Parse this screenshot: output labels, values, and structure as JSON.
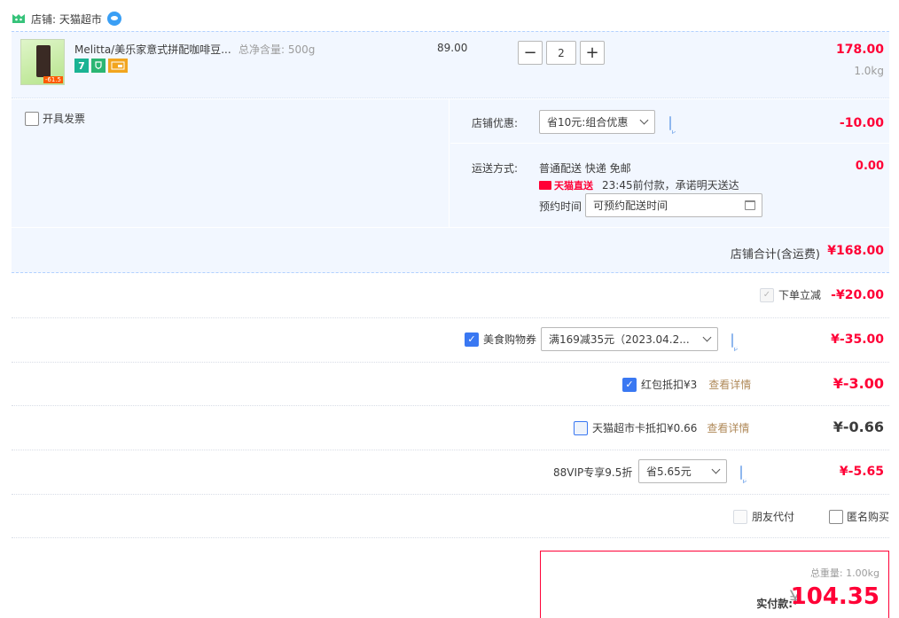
{
  "shop": {
    "label": "店铺: 天猫超市"
  },
  "item": {
    "title": "Melitta/美乐家意式拼配咖啡豆...",
    "spec": "总净含量: 500g",
    "badges": [
      "7",
      "",
      ""
    ],
    "unit_price": "89.00",
    "qty_minus": "−",
    "qty": "2",
    "qty_plus": "+",
    "sum": "178.00",
    "weight": "1.0kg",
    "thumb_tag": "-61.5"
  },
  "options": {
    "invoice_label": "开具发票",
    "shop_discount_label": "店铺优惠:",
    "shop_discount_value": "省10元:组合优惠",
    "shop_discount_amount": "-10.00",
    "delivery_label": "运送方式:",
    "delivery_value": "普通配送 快递 免邮",
    "delivery_amount": "0.00",
    "tmall_direct": "天猫直送",
    "delivery_promise": "23:45前付款，承诺明天送达",
    "schedule_label": "预约时间",
    "schedule_placeholder": "可预约配送时间",
    "shop_total": "店铺合计(含运费)",
    "shop_total_amount": "¥168.00"
  },
  "discounts": {
    "instant_label": "下单立减",
    "instant_amount": "-¥20.00",
    "coupon_label": "美食购物券",
    "coupon_value": "满169减35元（2023.04.2...",
    "coupon_amount": "¥-35.00",
    "redpacket_label": "红包抵扣¥3",
    "redpacket_link": "查看详情",
    "redpacket_amount": "¥-3.00",
    "card_label": "天猫超市卡抵扣¥0.66",
    "card_link": "查看详情",
    "card_amount": "¥-0.66",
    "vip_label": "88VIP专享9.5折",
    "vip_value": "省5.65元",
    "vip_amount": "¥-5.65",
    "friend_pay_label": "朋友代付",
    "anonymous_label": "匿名购买"
  },
  "payment": {
    "weight_label": "总重量: 1.00kg",
    "pay_label": "实付款:",
    "yen": "¥",
    "amount": "104.35"
  },
  "colors": {
    "accent_red": "#ff0036",
    "row_bg": "#f2f7ff",
    "checkbox_blue": "#3a78f2",
    "link_brown": "#b08a5a"
  }
}
